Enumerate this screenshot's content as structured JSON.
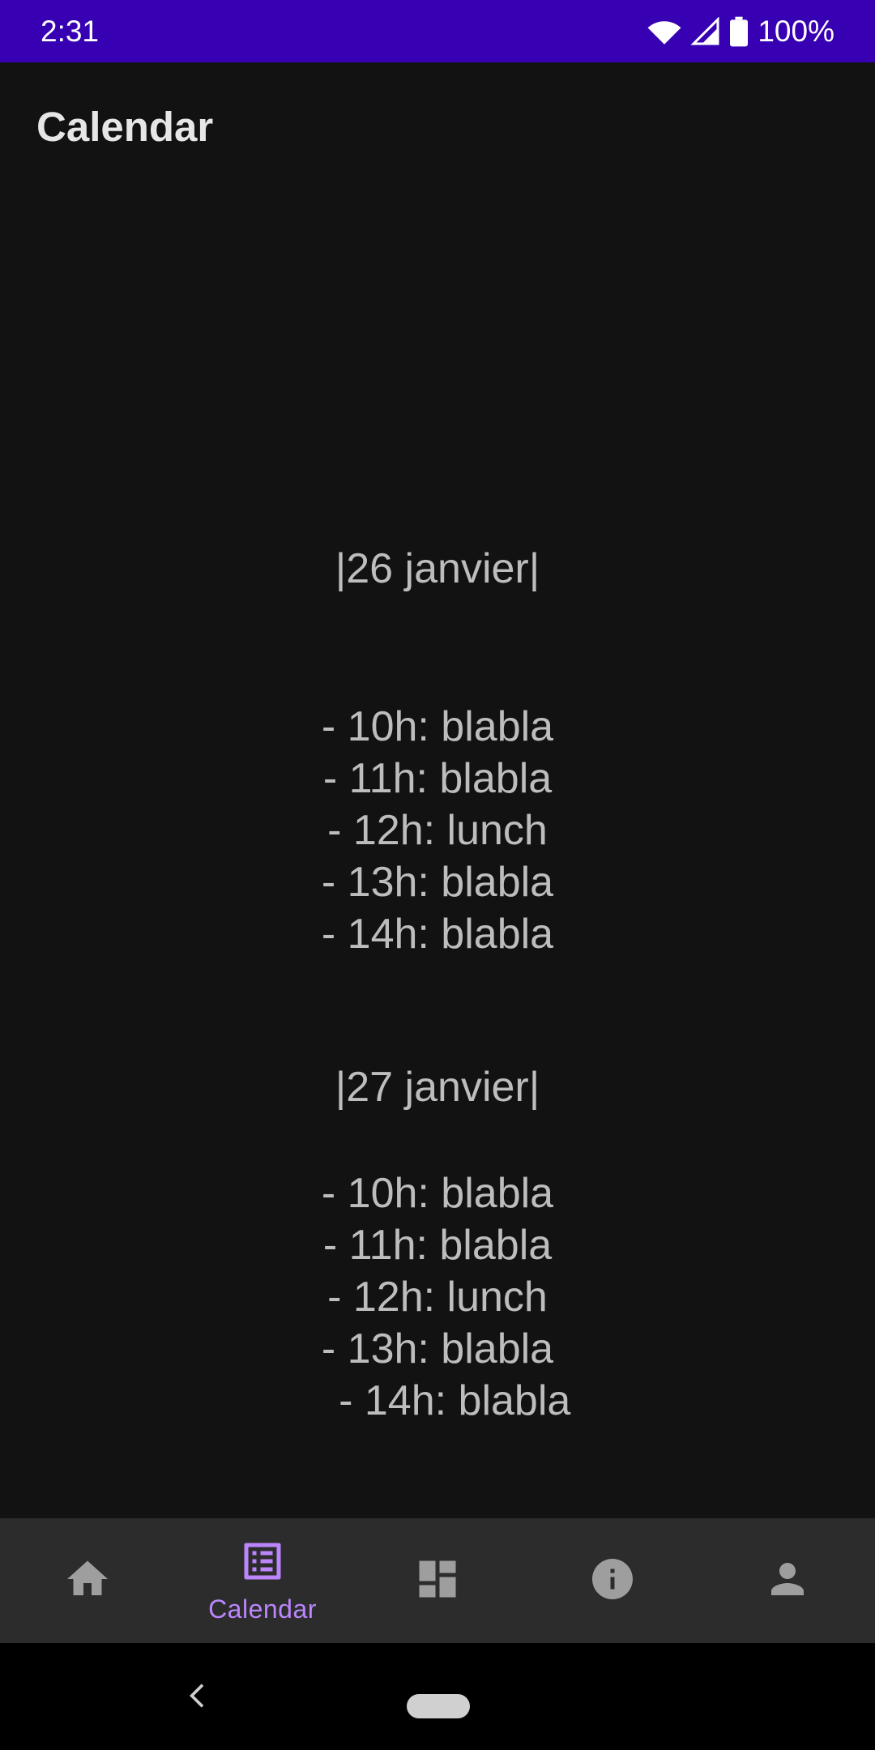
{
  "status_bar": {
    "time": "2:31",
    "battery_percent": "100%",
    "background_color": "#3700b3",
    "icons": [
      "wifi-icon",
      "cell-signal-icon",
      "battery-icon"
    ]
  },
  "app_bar": {
    "title": "Calendar"
  },
  "days": [
    {
      "heading": "|26 janvier|",
      "entries": [
        "- 10h: blabla",
        "- 11h: blabla",
        "- 12h: lunch",
        "- 13h: blabla",
        "- 14h: blabla"
      ]
    },
    {
      "heading": "|27 janvier|",
      "entries": [
        "- 10h: blabla",
        "- 11h: blabla",
        "- 12h: lunch",
        "- 13h: blabla",
        " - 14h: blabla"
      ]
    }
  ],
  "bottom_nav": {
    "items": [
      {
        "icon": "home-icon",
        "label": ""
      },
      {
        "icon": "list-icon",
        "label": "Calendar",
        "active": true
      },
      {
        "icon": "dashboard-icon",
        "label": ""
      },
      {
        "icon": "info-icon",
        "label": ""
      },
      {
        "icon": "person-icon",
        "label": ""
      }
    ],
    "active_color": "#bb86fc",
    "inactive_color": "#9e9e9e"
  }
}
